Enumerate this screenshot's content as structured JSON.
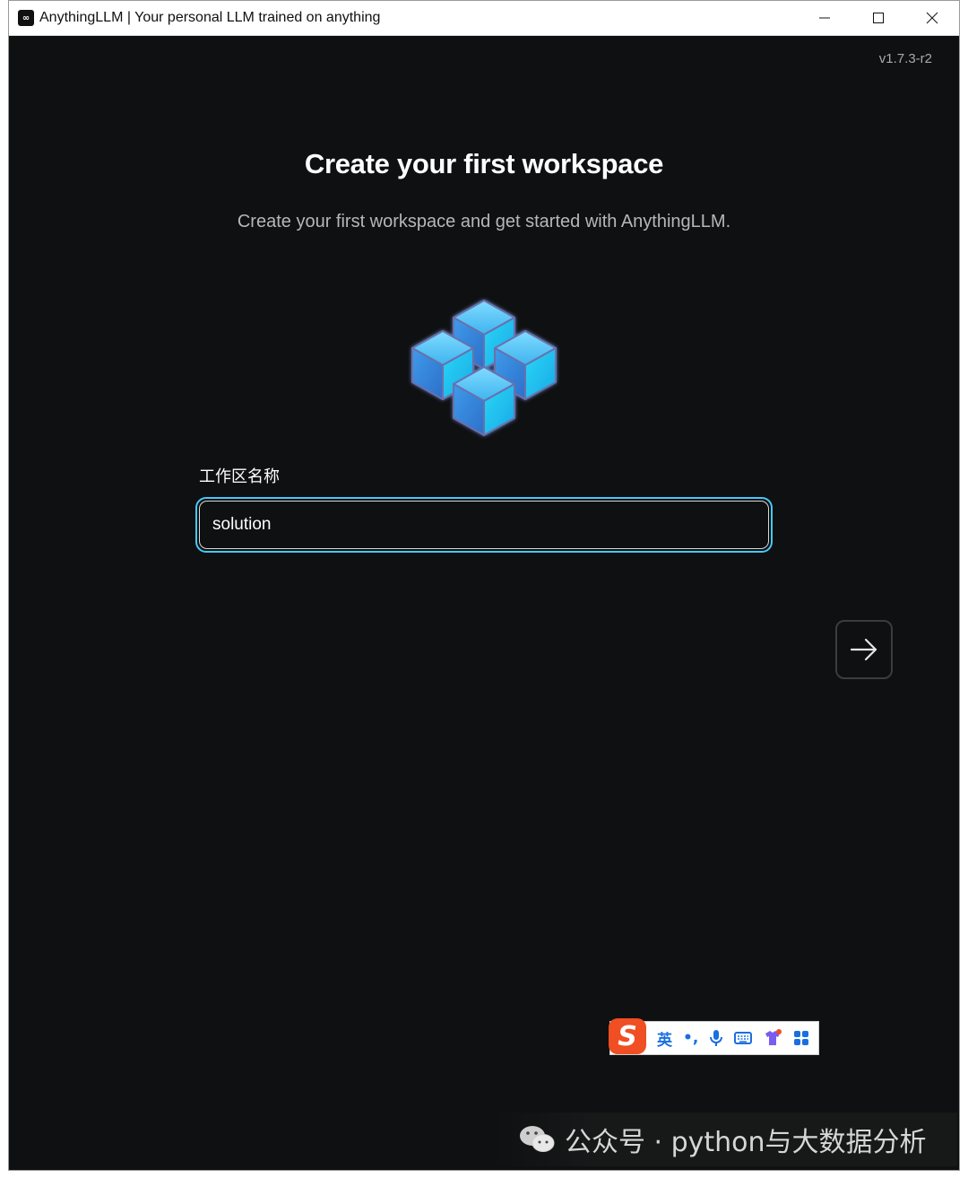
{
  "window": {
    "title": "AnythingLLM | Your personal LLM trained on anything",
    "app_icon_glyph": "∞",
    "controls": [
      "minimize-icon",
      "maximize-icon",
      "close-icon"
    ]
  },
  "version": "v1.7.3-r2",
  "onboarding": {
    "heading": "Create your first workspace",
    "subheading": "Create your first workspace and get started with AnythingLLM.",
    "illustration": "cubes-icon",
    "field_label": "工作区名称",
    "workspace_name_value": "solution",
    "next_icon": "arrow-right-icon"
  },
  "ime_toolbar": {
    "logo": "S",
    "mode": "英",
    "punct": "•,",
    "icons": [
      "microphone-icon",
      "keyboard-icon",
      "skin-icon",
      "apps-icon"
    ]
  },
  "watermark": {
    "text": "公众号 · python与大数据分析",
    "icon": "wechat-icon"
  },
  "colors": {
    "background": "#0e1011",
    "input_focus_ring": "#46c8ff",
    "cube": "#35c6f4"
  }
}
